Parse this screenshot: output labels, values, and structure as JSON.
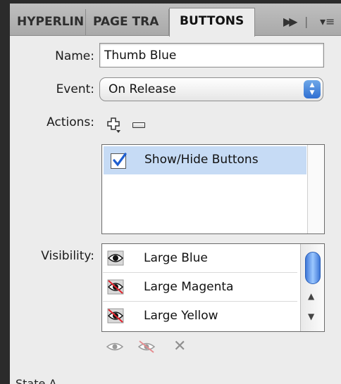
{
  "tabs": [
    {
      "label": "HYPERLIN"
    },
    {
      "label": "PAGE TRA"
    },
    {
      "label": "BUTTONS"
    }
  ],
  "tab_controls": {
    "expand": "▶▶",
    "separator": "|",
    "menu": "▾≡"
  },
  "form": {
    "name_label": "Name:",
    "name_value": "Thumb Blue",
    "event_label": "Event:",
    "event_value": "On Release",
    "actions_label": "Actions:",
    "visibility_label": "Visibility:"
  },
  "actions": [
    {
      "label": "Show/Hide Buttons",
      "checked": true
    }
  ],
  "visibility": [
    {
      "label": "Large Blue",
      "state": "show-icon"
    },
    {
      "label": "Large Magenta",
      "state": "hide-icon"
    },
    {
      "label": "Large Yellow",
      "state": "hide-icon"
    }
  ],
  "bottom_tools": {
    "clear": "✕"
  },
  "states_label": "State A",
  "colors": {
    "selection": "#c6dbf5",
    "accent": "#2f6fd2",
    "strike": "#e0202a"
  }
}
